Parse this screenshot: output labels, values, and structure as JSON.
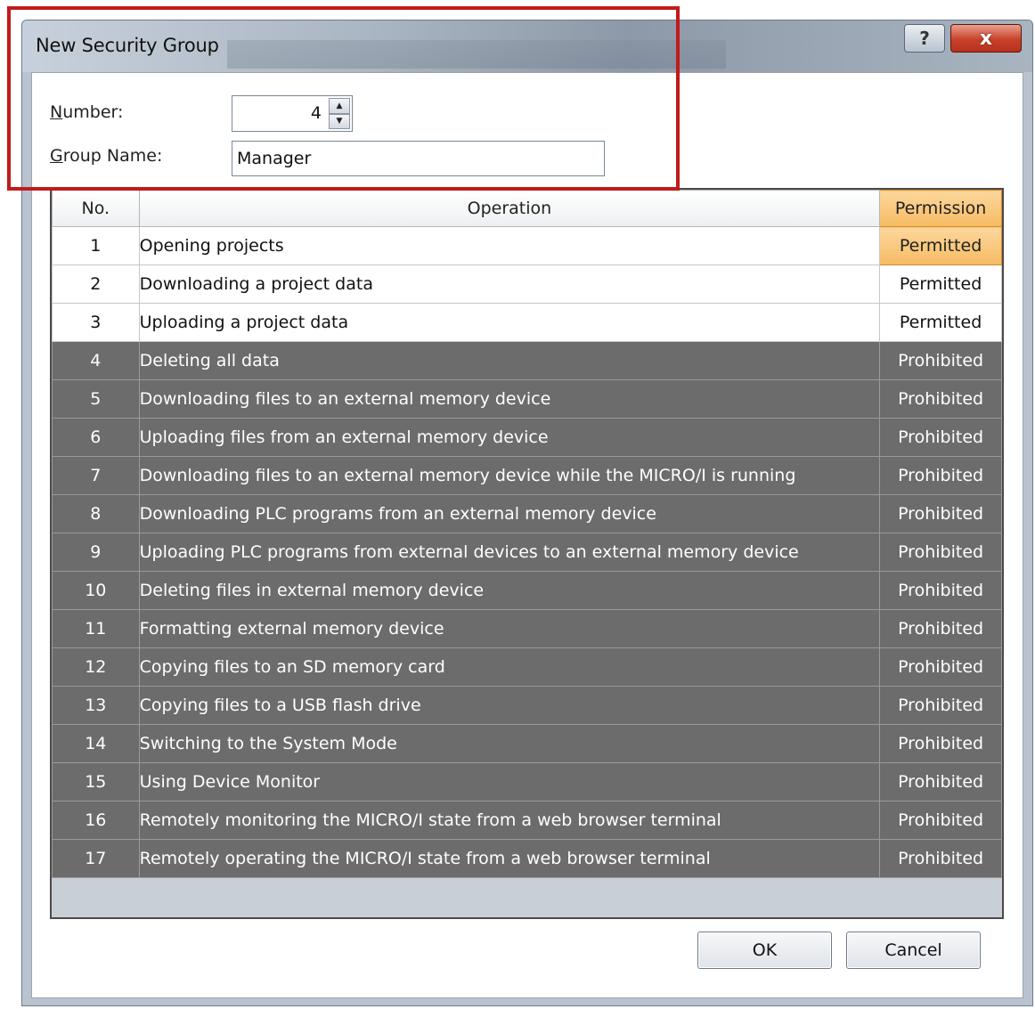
{
  "window": {
    "title": "New Security Group",
    "help_glyph": "?",
    "close_glyph": "x"
  },
  "form": {
    "number_label_key": "N",
    "number_label_rest": "umber:",
    "number_value": "4",
    "group_label_key": "G",
    "group_label_rest": "roup Name:",
    "group_value": "Manager"
  },
  "table": {
    "columns": [
      "No.",
      "Operation",
      "Permission"
    ],
    "rows": [
      {
        "no": "1",
        "operation": "Opening projects",
        "permission": "Permitted"
      },
      {
        "no": "2",
        "operation": "Downloading a project data",
        "permission": "Permitted"
      },
      {
        "no": "3",
        "operation": "Uploading a project data",
        "permission": "Permitted"
      },
      {
        "no": "4",
        "operation": "Deleting all data",
        "permission": "Prohibited"
      },
      {
        "no": "5",
        "operation": "Downloading files to an external memory device",
        "permission": "Prohibited"
      },
      {
        "no": "6",
        "operation": "Uploading files from an external memory device",
        "permission": "Prohibited"
      },
      {
        "no": "7",
        "operation": "Downloading files to an external memory device while the MICRO/I is running",
        "permission": "Prohibited"
      },
      {
        "no": "8",
        "operation": "Downloading PLC programs from an external memory device",
        "permission": "Prohibited"
      },
      {
        "no": "9",
        "operation": "Uploading PLC programs from external devices to an external memory device",
        "permission": "Prohibited"
      },
      {
        "no": "10",
        "operation": "Deleting files in external memory device",
        "permission": "Prohibited"
      },
      {
        "no": "11",
        "operation": "Formatting external memory device",
        "permission": "Prohibited"
      },
      {
        "no": "12",
        "operation": "Copying files to an SD memory card",
        "permission": "Prohibited"
      },
      {
        "no": "13",
        "operation": "Copying files to a USB flash drive",
        "permission": "Prohibited"
      },
      {
        "no": "14",
        "operation": "Switching to the System Mode",
        "permission": "Prohibited"
      },
      {
        "no": "15",
        "operation": "Using Device Monitor",
        "permission": "Prohibited"
      },
      {
        "no": "16",
        "operation": "Remotely monitoring the MICRO/I state from a web browser terminal",
        "permission": "Prohibited"
      },
      {
        "no": "17",
        "operation": "Remotely operating the MICRO/I state from a web browser terminal",
        "permission": "Prohibited"
      }
    ]
  },
  "buttons": {
    "ok": "OK",
    "cancel": "Cancel"
  },
  "colors": {
    "highlight_border": "#c11b1b",
    "selected_cell": "#f6bb63",
    "prohibited_row": "#6c6c6c"
  }
}
